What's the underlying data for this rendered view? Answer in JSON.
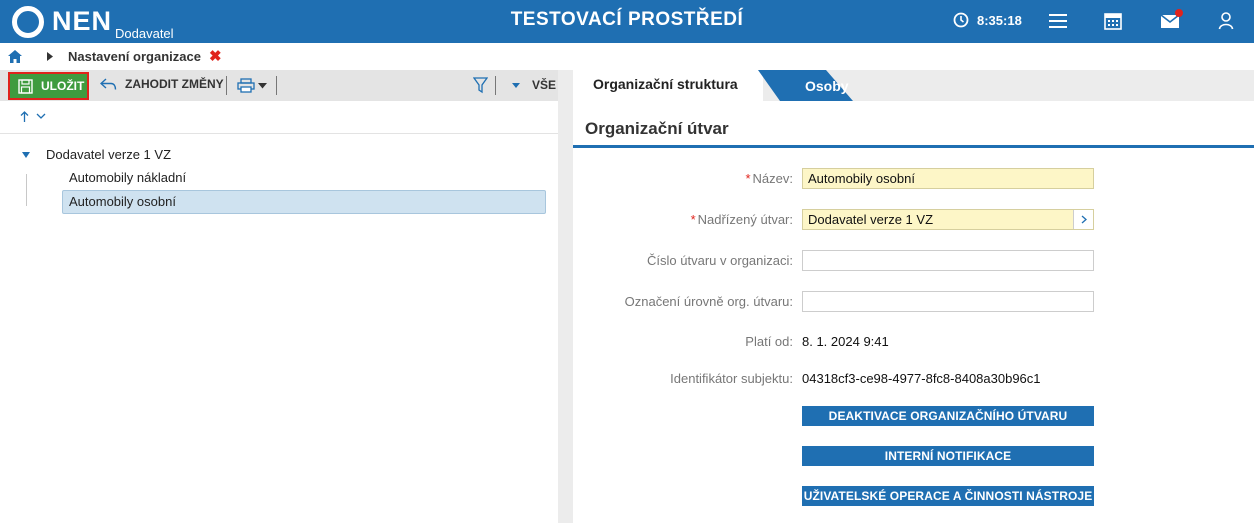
{
  "header": {
    "logo_text": "NEN",
    "logo_subtitle": "Dodavatel",
    "environment_title": "TESTOVACÍ PROSTŘEDÍ",
    "time": "8:35:18",
    "colors": {
      "header_bg": "#1f6fb2",
      "notification_dot": "#e0231c"
    },
    "icons": [
      "clock-icon",
      "menu-icon",
      "calendar-icon",
      "mail-icon",
      "user-icon"
    ]
  },
  "breadcrumb": {
    "page_label": "Nastavení organizace",
    "close_glyph": "✖"
  },
  "toolbar": {
    "save_label": "ULOŽIT",
    "discard_label": "ZAHODIT ZMĚNY",
    "filter_scope_label": "VŠE",
    "colors": {
      "save_bg": "#3f9b3f",
      "save_border": "#e0231c"
    }
  },
  "tree": {
    "root_label": "Dodavatel verze 1 VZ",
    "children": [
      {
        "label": "Automobily nákladní",
        "selected": false
      },
      {
        "label": "Automobily osobní",
        "selected": true
      }
    ]
  },
  "tabs": [
    {
      "label": "Organizační struktura",
      "active": true
    },
    {
      "label": "Osoby",
      "active": false
    }
  ],
  "form": {
    "section_title": "Organizační útvar",
    "fields": {
      "name": {
        "label": "Název:",
        "value": "Automobily osobní",
        "required": true
      },
      "parent": {
        "label": "Nadřízený útvar:",
        "value": "Dodavatel verze 1 VZ",
        "required": true
      },
      "unit_number": {
        "label": "Číslo útvaru v organizaci:",
        "value": ""
      },
      "level_mark": {
        "label": "Označení úrovně org. útvaru:",
        "value": ""
      },
      "valid_from": {
        "label": "Platí od:",
        "value": "8. 1. 2024 9:41"
      },
      "subject_id": {
        "label": "Identifikátor subjektu:",
        "value": "04318cf3-ce98-4977-8fc8-8408a30b96c1"
      }
    },
    "actions": {
      "deactivate": "DEAKTIVACE ORGANIZAČNÍHO ÚTVARU",
      "notifications": "INTERNÍ NOTIFIKACE",
      "user_operations": "UŽIVATELSKÉ OPERACE A ČINNOSTI NÁSTROJE"
    },
    "required_marker": "*"
  }
}
